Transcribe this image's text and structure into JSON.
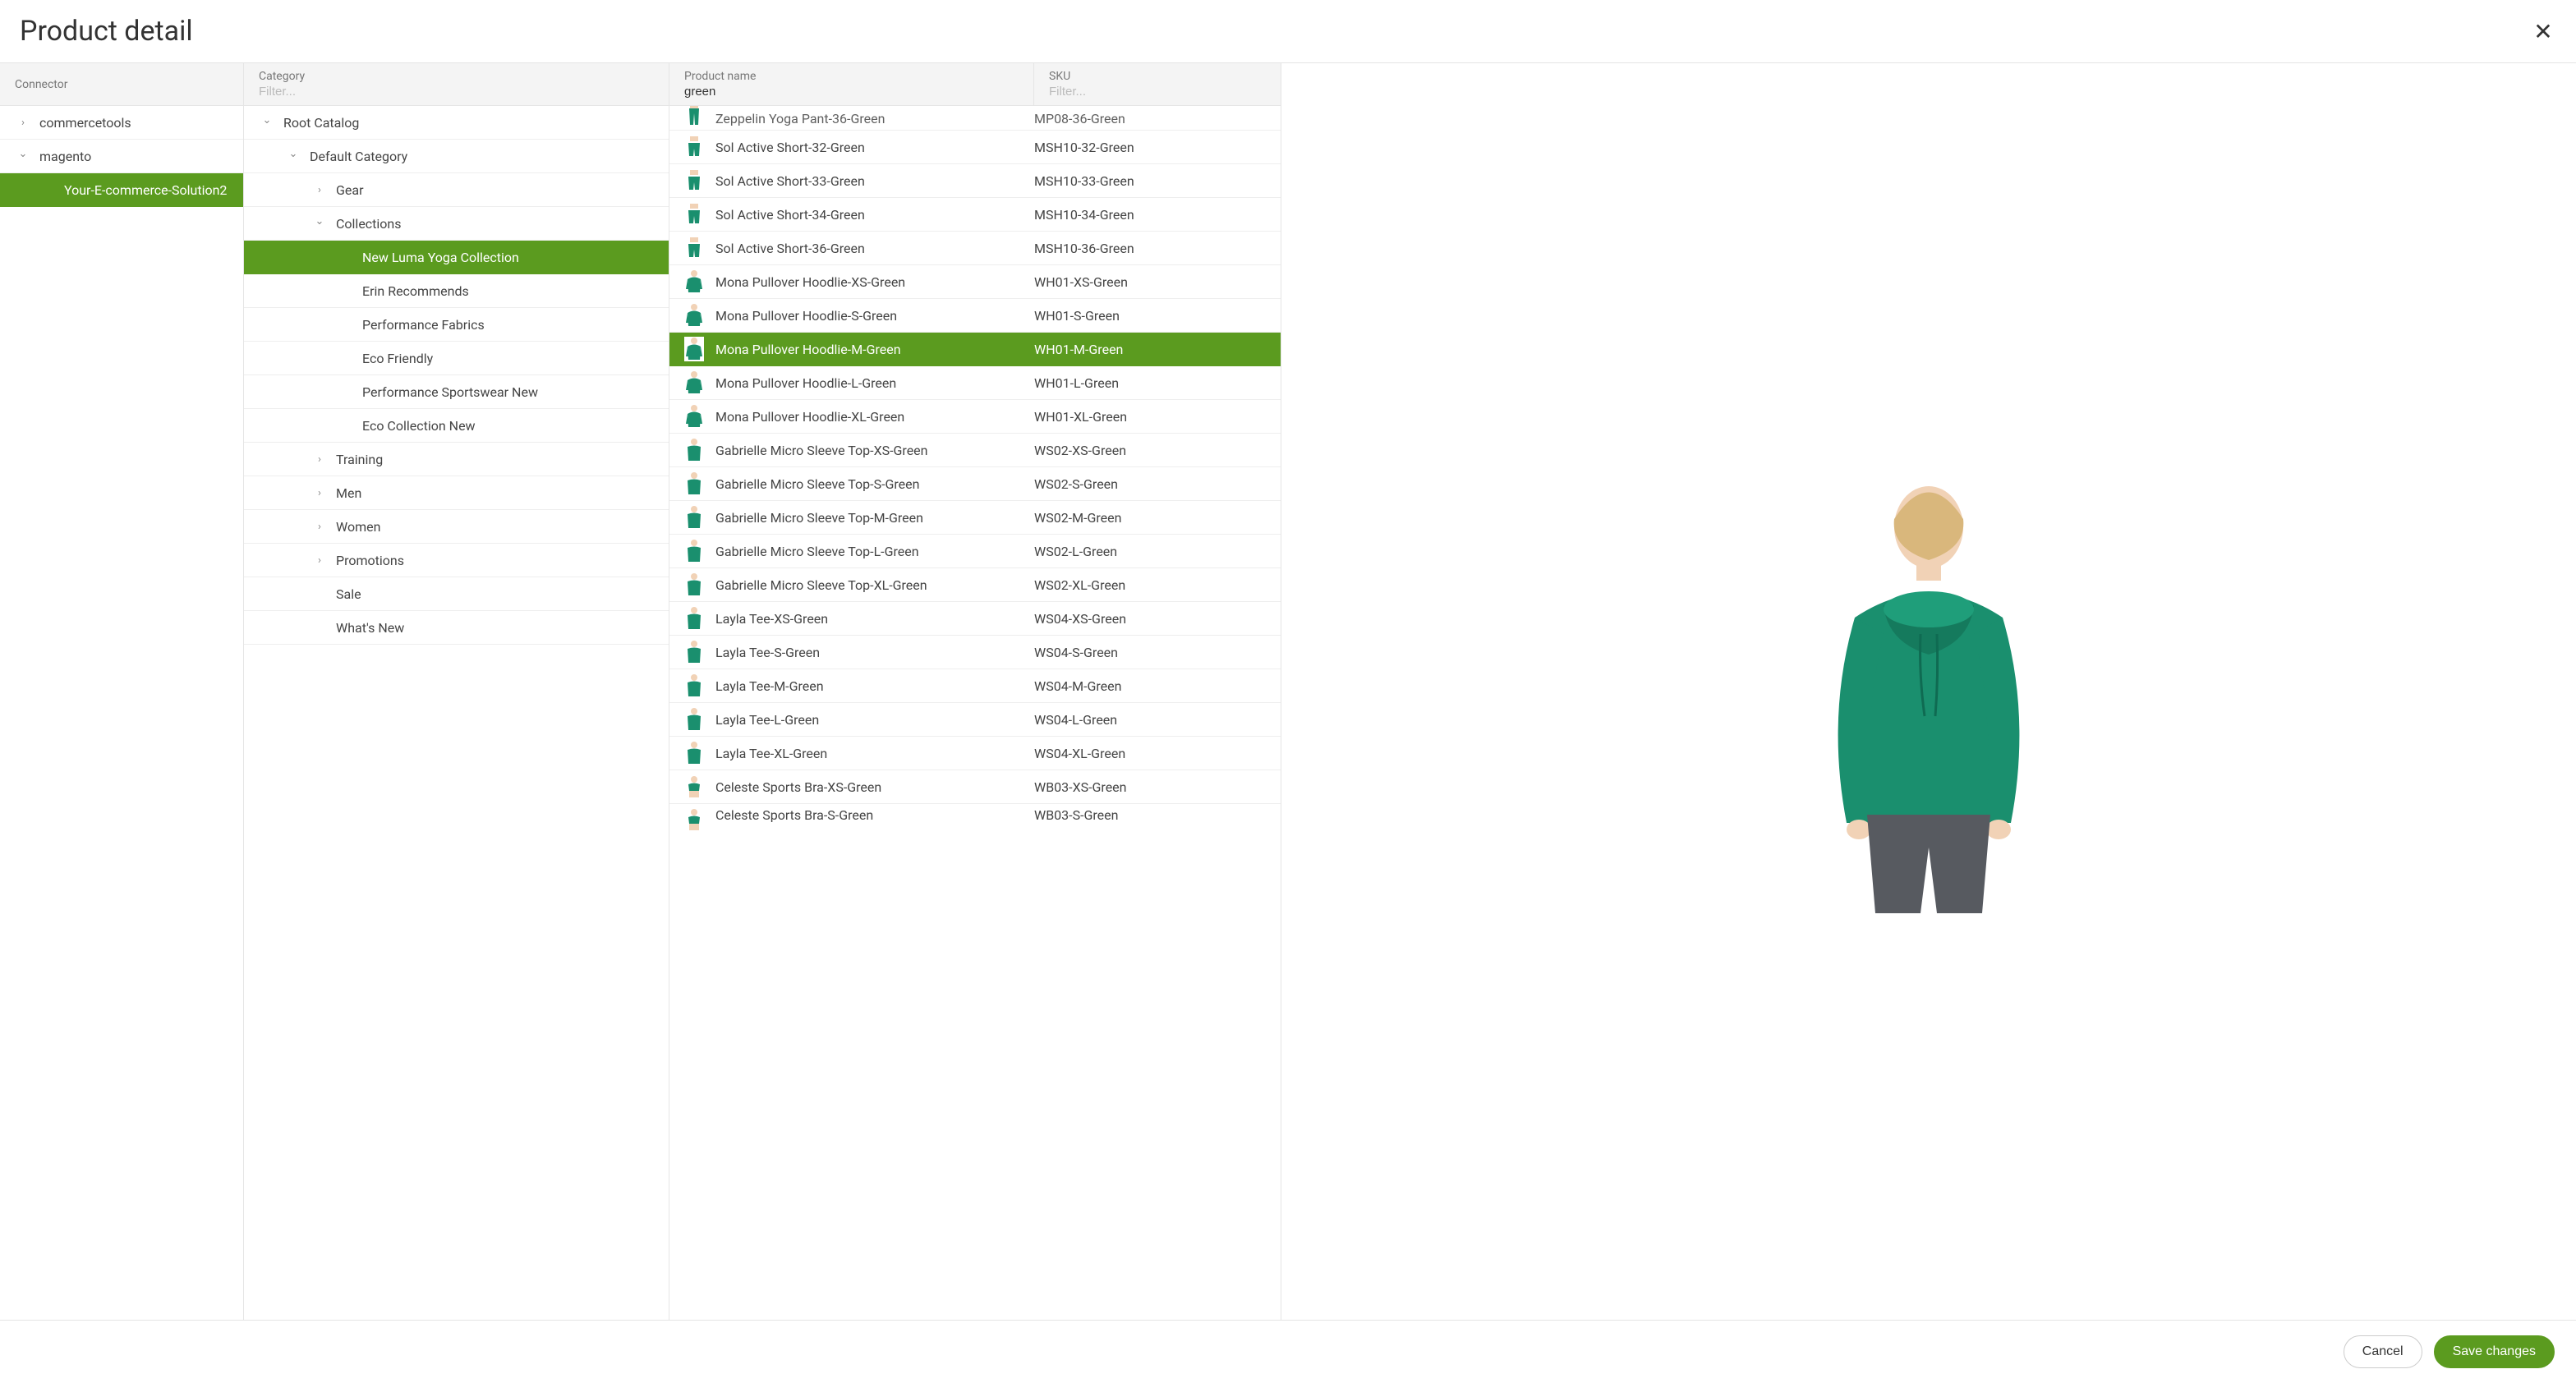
{
  "title": "Product detail",
  "buttons": {
    "cancel": "Cancel",
    "save": "Save changes"
  },
  "columns": {
    "connector": {
      "label": "Connector"
    },
    "category": {
      "label": "Category",
      "filter_placeholder": "Filter...",
      "filter_value": ""
    },
    "product": {
      "label": "Product name",
      "filter_value": "green"
    },
    "sku": {
      "label": "SKU",
      "filter_placeholder": "Filter...",
      "filter_value": ""
    }
  },
  "connectors": [
    {
      "name": "commercetools",
      "expanded": false,
      "selected": false,
      "depth": 0
    },
    {
      "name": "magento",
      "expanded": true,
      "selected": false,
      "depth": 0
    },
    {
      "name": "Your-E-commerce-Solution2",
      "expanded": null,
      "selected": true,
      "depth": 1
    }
  ],
  "categories": [
    {
      "name": "Root Catalog",
      "depth": 0,
      "arrow": "down",
      "selected": false
    },
    {
      "name": "Default Category",
      "depth": 1,
      "arrow": "down",
      "selected": false
    },
    {
      "name": "Gear",
      "depth": 2,
      "arrow": "right",
      "selected": false
    },
    {
      "name": "Collections",
      "depth": 2,
      "arrow": "down",
      "selected": false
    },
    {
      "name": "New Luma Yoga Collection",
      "depth": 3,
      "arrow": null,
      "selected": true
    },
    {
      "name": "Erin Recommends",
      "depth": 3,
      "arrow": null,
      "selected": false
    },
    {
      "name": "Performance Fabrics",
      "depth": 3,
      "arrow": null,
      "selected": false
    },
    {
      "name": "Eco Friendly",
      "depth": 3,
      "arrow": null,
      "selected": false
    },
    {
      "name": "Performance Sportswear New",
      "depth": 3,
      "arrow": null,
      "selected": false
    },
    {
      "name": "Eco Collection New",
      "depth": 3,
      "arrow": null,
      "selected": false
    },
    {
      "name": "Training",
      "depth": 2,
      "arrow": "right",
      "selected": false
    },
    {
      "name": "Men",
      "depth": 2,
      "arrow": "right",
      "selected": false
    },
    {
      "name": "Women",
      "depth": 2,
      "arrow": "right",
      "selected": false
    },
    {
      "name": "Promotions",
      "depth": 2,
      "arrow": "right",
      "selected": false
    },
    {
      "name": "Sale",
      "depth": 2,
      "arrow": null,
      "selected": false
    },
    {
      "name": "What's New",
      "depth": 2,
      "arrow": null,
      "selected": false
    }
  ],
  "products": [
    {
      "name": "Zeppelin Yoga Pant-36-Green",
      "sku": "MP08-36-Green",
      "thumb": "pant",
      "selected": false,
      "cut": "top"
    },
    {
      "name": "Sol Active Short-32-Green",
      "sku": "MSH10-32-Green",
      "thumb": "short",
      "selected": false
    },
    {
      "name": "Sol Active Short-33-Green",
      "sku": "MSH10-33-Green",
      "thumb": "short",
      "selected": false
    },
    {
      "name": "Sol Active Short-34-Green",
      "sku": "MSH10-34-Green",
      "thumb": "short",
      "selected": false
    },
    {
      "name": "Sol Active Short-36-Green",
      "sku": "MSH10-36-Green",
      "thumb": "short",
      "selected": false
    },
    {
      "name": "Mona Pullover Hoodlie-XS-Green",
      "sku": "WH01-XS-Green",
      "thumb": "hoodie",
      "selected": false
    },
    {
      "name": "Mona Pullover Hoodlie-S-Green",
      "sku": "WH01-S-Green",
      "thumb": "hoodie",
      "selected": false
    },
    {
      "name": "Mona Pullover Hoodlie-M-Green",
      "sku": "WH01-M-Green",
      "thumb": "hoodie",
      "selected": true
    },
    {
      "name": "Mona Pullover Hoodlie-L-Green",
      "sku": "WH01-L-Green",
      "thumb": "hoodie",
      "selected": false
    },
    {
      "name": "Mona Pullover Hoodlie-XL-Green",
      "sku": "WH01-XL-Green",
      "thumb": "hoodie",
      "selected": false
    },
    {
      "name": "Gabrielle Micro Sleeve Top-XS-Green",
      "sku": "WS02-XS-Green",
      "thumb": "tee",
      "selected": false
    },
    {
      "name": "Gabrielle Micro Sleeve Top-S-Green",
      "sku": "WS02-S-Green",
      "thumb": "tee",
      "selected": false
    },
    {
      "name": "Gabrielle Micro Sleeve Top-M-Green",
      "sku": "WS02-M-Green",
      "thumb": "tee",
      "selected": false
    },
    {
      "name": "Gabrielle Micro Sleeve Top-L-Green",
      "sku": "WS02-L-Green",
      "thumb": "tee",
      "selected": false
    },
    {
      "name": "Gabrielle Micro Sleeve Top-XL-Green",
      "sku": "WS02-XL-Green",
      "thumb": "tee",
      "selected": false
    },
    {
      "name": "Layla Tee-XS-Green",
      "sku": "WS04-XS-Green",
      "thumb": "tee",
      "selected": false
    },
    {
      "name": "Layla Tee-S-Green",
      "sku": "WS04-S-Green",
      "thumb": "tee",
      "selected": false
    },
    {
      "name": "Layla Tee-M-Green",
      "sku": "WS04-M-Green",
      "thumb": "tee",
      "selected": false
    },
    {
      "name": "Layla Tee-L-Green",
      "sku": "WS04-L-Green",
      "thumb": "tee",
      "selected": false
    },
    {
      "name": "Layla Tee-XL-Green",
      "sku": "WS04-XL-Green",
      "thumb": "tee",
      "selected": false
    },
    {
      "name": "Celeste Sports Bra-XS-Green",
      "sku": "WB03-XS-Green",
      "thumb": "bra",
      "selected": false
    },
    {
      "name": "Celeste Sports Bra-S-Green",
      "sku": "WB03-S-Green",
      "thumb": "bra",
      "selected": false,
      "cut": "bottom"
    }
  ],
  "preview": {
    "productName": "Mona Pullover Hoodlie-M-Green",
    "colorHex": "#1a8f6e"
  }
}
